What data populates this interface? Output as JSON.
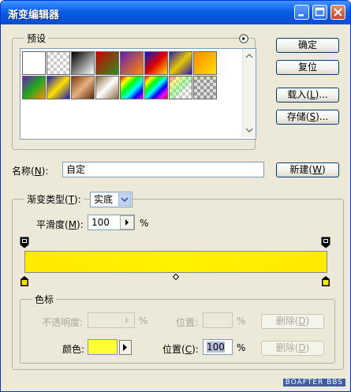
{
  "window": {
    "title": "渐变编辑器"
  },
  "presets": {
    "group_label": "预设",
    "swatches": [
      {
        "row": 0,
        "col": 0,
        "style": "linear-gradient(90deg,#ffffff,#ffffff)"
      },
      {
        "row": 0,
        "col": 1,
        "style": "checker-white"
      },
      {
        "row": 0,
        "col": 2,
        "style": "linear-gradient(135deg,#000,#fff)"
      },
      {
        "row": 0,
        "col": 3,
        "style": "linear-gradient(135deg,#d10000,#2d8f1e)"
      },
      {
        "row": 0,
        "col": 4,
        "style": "linear-gradient(135deg,#6a1bb5,#ff8c00)"
      },
      {
        "row": 0,
        "col": 5,
        "style": "linear-gradient(135deg,#0b19c9,#e00000,#ffe000)"
      },
      {
        "row": 0,
        "col": 6,
        "style": "linear-gradient(135deg,#2a1bb0,#e8c800,#2a1bb0)"
      },
      {
        "row": 0,
        "col": 7,
        "style": "linear-gradient(135deg,#ff8a00,#ffe000)"
      },
      {
        "row": 1,
        "col": 0,
        "style": "linear-gradient(135deg,#6a1bb5,#1fa81f,#ff8c00)"
      },
      {
        "row": 1,
        "col": 1,
        "style": "linear-gradient(135deg,#1a1ab0,#ffe000,#1a1ab0)"
      },
      {
        "row": 1,
        "col": 2,
        "style": "linear-gradient(135deg,#7a3a10,#e8b080,#5a2a08)"
      },
      {
        "row": 1,
        "col": 3,
        "style": "linear-gradient(135deg,#8a6a40,#fff,#8a6a40)"
      },
      {
        "row": 1,
        "col": 4,
        "style": "linear-gradient(135deg,#ff0000,#ff0,#0f0,#0ff,#00f,#f0f)"
      },
      {
        "row": 1,
        "col": 5,
        "style": "linear-gradient(135deg,#f00,#ff0,#0f0,#0ff,#00f,#f0f,#f00)"
      },
      {
        "row": 1,
        "col": 6,
        "style": "checker-rainbow"
      },
      {
        "row": 1,
        "col": 7,
        "style": "checker-gray"
      }
    ]
  },
  "buttons": {
    "ok": "确定",
    "reset": "复位",
    "load_prefix": "载入(",
    "load_key": "L",
    "load_suffix": ")...",
    "save_prefix": "存储(",
    "save_key": "S",
    "save_suffix": ")...",
    "new_prefix": "新建(",
    "new_key": "W",
    "new_suffix": ")"
  },
  "name": {
    "label_prefix": "名称(",
    "label_key": "N",
    "label_suffix": "):",
    "value": "自定"
  },
  "gradient_type": {
    "label_prefix": "渐变类型(",
    "label_key": "T",
    "label_suffix": "):",
    "value": "实底"
  },
  "smoothness": {
    "label_prefix": "平滑度(",
    "label_key": "M",
    "label_suffix": "):",
    "value": "100",
    "unit": "%"
  },
  "gradient": {
    "color_start": "#ffea00",
    "color_end": "#ffea00",
    "midpoint": 0.5
  },
  "color_stops": {
    "group_label": "色标",
    "opacity_label": "不透明度:",
    "opacity_unit": "%",
    "location_label": "位置:",
    "location_unit": "%",
    "delete_prefix": "删除(",
    "delete_key": "D",
    "delete_suffix": ")",
    "color_label": "颜色:",
    "color_value": "#ffff33",
    "location2_prefix": "位置(",
    "location2_key": "C",
    "location2_suffix": "):",
    "location2_value": "100",
    "location2_unit": "%"
  },
  "watermark": "BOAFTER BBS"
}
